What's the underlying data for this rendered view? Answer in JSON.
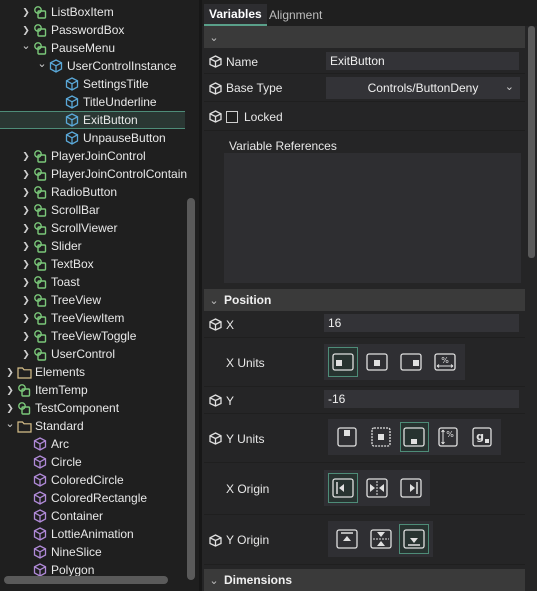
{
  "tree": {
    "items": [
      {
        "label": "ListBoxItem",
        "icon": "component-icon",
        "arrow": "collapsed"
      },
      {
        "label": "PasswordBox",
        "icon": "component-icon",
        "arrow": "collapsed"
      },
      {
        "label": "PauseMenu",
        "icon": "component-icon",
        "arrow": "expanded"
      },
      {
        "label": "UserControlInstance",
        "icon": "instance-icon",
        "arrow": "expanded"
      },
      {
        "label": "SettingsTitle",
        "icon": "instance-icon",
        "arrow": "none"
      },
      {
        "label": "TitleUnderline",
        "icon": "instance-icon",
        "arrow": "none"
      },
      {
        "label": "ExitButton",
        "icon": "instance-icon",
        "arrow": "none",
        "selected": true
      },
      {
        "label": "UnpauseButton",
        "icon": "instance-icon",
        "arrow": "none"
      },
      {
        "label": "PlayerJoinControl",
        "icon": "component-icon",
        "arrow": "collapsed"
      },
      {
        "label": "PlayerJoinControlContain",
        "icon": "component-icon",
        "arrow": "collapsed"
      },
      {
        "label": "RadioButton",
        "icon": "component-icon",
        "arrow": "collapsed"
      },
      {
        "label": "ScrollBar",
        "icon": "component-icon",
        "arrow": "collapsed"
      },
      {
        "label": "ScrollViewer",
        "icon": "component-icon",
        "arrow": "collapsed"
      },
      {
        "label": "Slider",
        "icon": "component-icon",
        "arrow": "collapsed"
      },
      {
        "label": "TextBox",
        "icon": "component-icon",
        "arrow": "collapsed"
      },
      {
        "label": "Toast",
        "icon": "component-icon",
        "arrow": "collapsed"
      },
      {
        "label": "TreeView",
        "icon": "component-icon",
        "arrow": "collapsed"
      },
      {
        "label": "TreeViewItem",
        "icon": "component-icon",
        "arrow": "collapsed"
      },
      {
        "label": "TreeViewToggle",
        "icon": "component-icon",
        "arrow": "collapsed"
      },
      {
        "label": "UserControl",
        "icon": "component-icon",
        "arrow": "collapsed"
      },
      {
        "label": "Elements",
        "icon": "folder-icon",
        "arrow": "collapsed"
      },
      {
        "label": "ItemTemp",
        "icon": "component-icon",
        "arrow": "collapsed"
      },
      {
        "label": "TestComponent",
        "icon": "component-icon",
        "arrow": "collapsed"
      },
      {
        "label": "Standard",
        "icon": "folder-icon",
        "arrow": "expanded"
      },
      {
        "label": "Arc",
        "icon": "standard-icon",
        "arrow": "none"
      },
      {
        "label": "Circle",
        "icon": "standard-icon",
        "arrow": "none"
      },
      {
        "label": "ColoredCircle",
        "icon": "standard-icon",
        "arrow": "none"
      },
      {
        "label": "ColoredRectangle",
        "icon": "standard-icon",
        "arrow": "none"
      },
      {
        "label": "Container",
        "icon": "standard-icon",
        "arrow": "none"
      },
      {
        "label": "LottieAnimation",
        "icon": "standard-icon",
        "arrow": "none"
      },
      {
        "label": "NineSlice",
        "icon": "standard-icon",
        "arrow": "none"
      },
      {
        "label": "Polygon",
        "icon": "standard-icon",
        "arrow": "none"
      }
    ]
  },
  "tabs": {
    "variables": "Variables",
    "alignment": "Alignment"
  },
  "props": {
    "name_label": "Name",
    "name_value": "ExitButton",
    "base_type_label": "Base Type",
    "base_type_value": "Controls/ButtonDeny",
    "locked_label": "Locked",
    "var_refs_label": "Variable References",
    "position_title": "Position",
    "x_label": "X",
    "x_value": "16",
    "x_units_label": "X Units",
    "y_label": "Y",
    "y_value": "-16",
    "y_units_label": "Y Units",
    "x_origin_label": "X Origin",
    "y_origin_label": "Y Origin",
    "dimensions_title": "Dimensions"
  },
  "colors": {
    "accent": "#4e8c78",
    "component_icon": "#7bc87a",
    "instance_icon": "#5aa8d8",
    "standard_icon": "#b08ad8",
    "folder_icon": "#d8c08a"
  }
}
